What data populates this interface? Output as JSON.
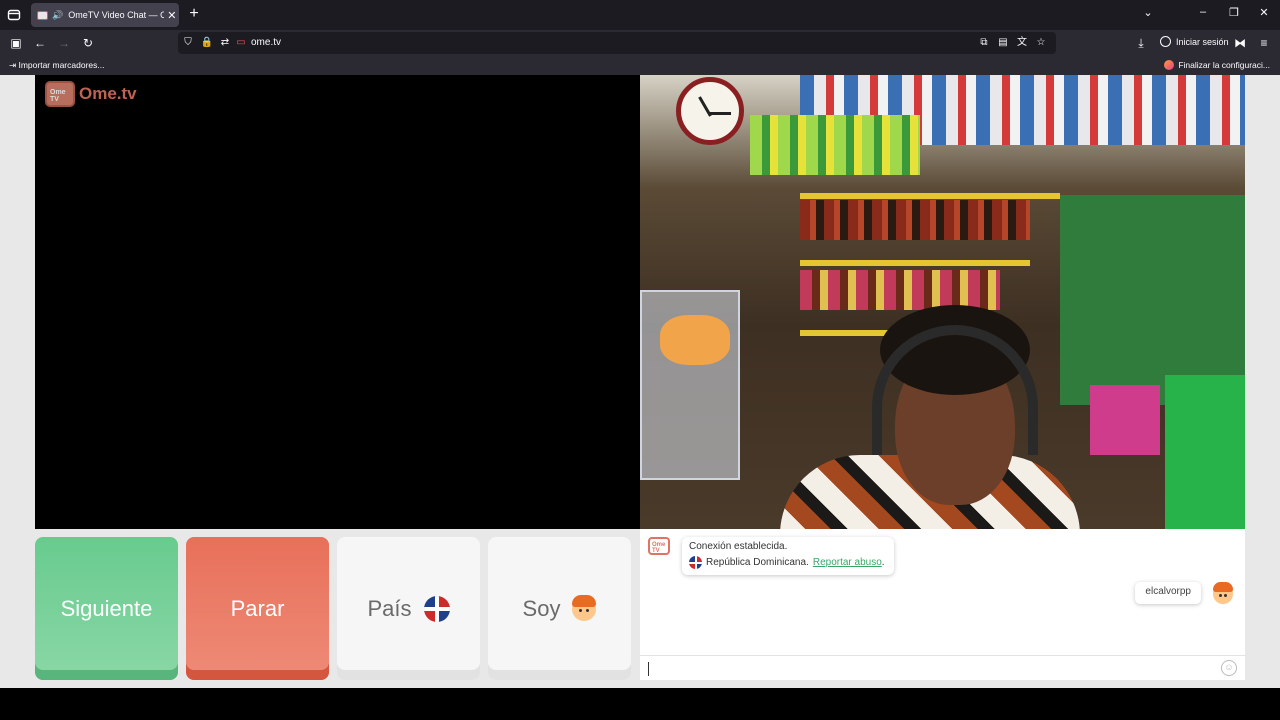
{
  "browser": {
    "tab_title": "OmeTV Video Chat — OmeTV",
    "url": "ome.tv",
    "signin_label": "Iniciar sesión",
    "bookmarks": {
      "import_label": "Importar marcadores...",
      "finish_label": "Finalizar la configuraci..."
    }
  },
  "site": {
    "logo_badge": "Ome TV",
    "logo_text": "Ome.tv"
  },
  "controls": {
    "next_label": "Siguiente",
    "stop_label": "Parar",
    "country_label": "País",
    "me_label": "Soy"
  },
  "chat": {
    "logo_badge": "Ome TV",
    "connection_text": "Conexión establecida.",
    "country_text": "República Dominicana.",
    "report_link": "Reportar abuso",
    "report_suffix": ".",
    "username": "elcalvorpp"
  },
  "colors": {
    "next": "#68cb8e",
    "stop": "#e8705a",
    "brand": "#e07462",
    "link": "#3aa66a"
  }
}
